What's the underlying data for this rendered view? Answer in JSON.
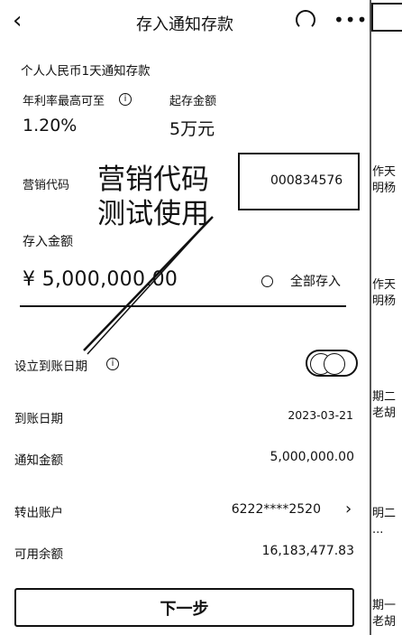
{
  "nav": {
    "back_icon": "chevron-left-icon",
    "title": "存入通知存款",
    "headset_icon": "headset-icon",
    "more_icon": "more-icon"
  },
  "product": {
    "name": "个人人民币1天通知存款"
  },
  "rate": {
    "label": "年利率最高可至",
    "value": "1.20%"
  },
  "min_deposit": {
    "label": "起存金额",
    "value": "5万元"
  },
  "marketing": {
    "label": "营销代码",
    "value": "000834576"
  },
  "annotation": {
    "line1": "营销代码",
    "line2": "测试使用"
  },
  "deposit_amount": {
    "label": "存入金额",
    "currency": "¥",
    "value": "5,000,000.00",
    "all_label": "全部存入"
  },
  "set_date": {
    "label": "设立到账日期",
    "toggle": "on"
  },
  "rows": [
    {
      "label": "到账日期",
      "value": "2023-03-21"
    },
    {
      "label": "通知金额",
      "value": "5,000,000.00"
    },
    {
      "label": "转出账户",
      "value": "6222****2520"
    },
    {
      "label": "可用余额",
      "value": "16,183,477.83"
    }
  ],
  "next_button": {
    "label": "下一步"
  },
  "right_strip": [
    {
      "text": "作天\n明杨"
    },
    {
      "text": "作天\n明杨"
    },
    {
      "text": "期二\n老胡"
    },
    {
      "text": "明二\n..."
    },
    {
      "text": "期一\n老胡"
    }
  ]
}
